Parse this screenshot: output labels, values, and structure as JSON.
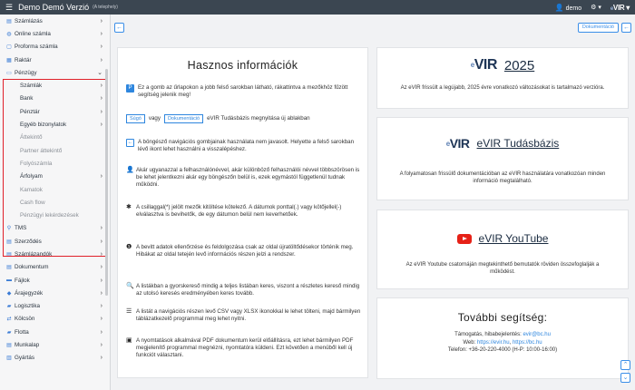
{
  "topbar": {
    "title": "Demo Demó Verzió",
    "subtitle": "(A telephely)",
    "user": "demo",
    "settings_icon": "gear-icon",
    "logo_e": "e",
    "logo_text": "VIR"
  },
  "sidebar": {
    "items": [
      {
        "label": "Számlázás",
        "icon": "document-icon"
      },
      {
        "label": "Online számla",
        "icon": "globe-icon"
      },
      {
        "label": "Proforma számla",
        "icon": "file-icon"
      },
      {
        "label": "Raktár",
        "icon": "warehouse-icon"
      },
      {
        "label": "Pénzügy",
        "icon": "money-icon"
      }
    ],
    "finance_sub": [
      {
        "label": "Számlák",
        "gray": false,
        "chev": true
      },
      {
        "label": "Bank",
        "gray": false,
        "chev": true
      },
      {
        "label": "Pénztár",
        "gray": false,
        "chev": true
      },
      {
        "label": "Egyéb bizonylatok",
        "gray": false,
        "chev": true
      },
      {
        "label": "Áttekintő",
        "gray": true,
        "chev": false
      },
      {
        "label": "Partner áttekintő",
        "gray": true,
        "chev": false
      },
      {
        "label": "Folyószámla",
        "gray": true,
        "chev": false
      },
      {
        "label": "Árfolyam",
        "gray": false,
        "chev": true
      },
      {
        "label": "Kamatok",
        "gray": true,
        "chev": false
      },
      {
        "label": "Cash flow",
        "gray": true,
        "chev": false
      },
      {
        "label": "Pénzügyi lekérdezések",
        "gray": true,
        "chev": false
      }
    ],
    "items_after": [
      {
        "label": "TMS",
        "icon": "pin-icon"
      },
      {
        "label": "Szerződés",
        "icon": "contract-icon"
      },
      {
        "label": "Számlázandók",
        "icon": "invoice-icon"
      },
      {
        "label": "Dokumentum",
        "icon": "document-icon"
      },
      {
        "label": "Fájlok",
        "icon": "folder-icon"
      },
      {
        "label": "Árajegyzék",
        "icon": "tag-icon"
      },
      {
        "label": "Logisztika",
        "icon": "truck-icon"
      },
      {
        "label": "Kölcsön",
        "icon": "loan-icon"
      },
      {
        "label": "Flotta",
        "icon": "car-icon"
      },
      {
        "label": "Munkalap",
        "icon": "worksheet-icon"
      },
      {
        "label": "Gyártás",
        "icon": "factory-icon"
      }
    ]
  },
  "toolbar": {
    "back_icon": "arrow-left-icon",
    "doc_label": "Dokumentáció"
  },
  "info": {
    "title": "Hasznos információk",
    "item1": "Ez a gomb az űrlapokon a jobb felső sarokban látható, rákattintva a mezőkhöz fűzött segítség jelenik meg!",
    "help_tag": "Súgó",
    "vagy": "vagy",
    "doc_tag": "Dokumentáció",
    "tudasbazis_text": "eVIR Tudásbázis megnyitása új ablakban",
    "item3": "A böngésző navigációs gombjainak használata nem javasolt. Helyette a felső sarokban lévő ikont lehet használni a visszalépéshez.",
    "item4": "Akár ugyanazzal a felhasználónévvel, akár különböző felhasználói névvel többszörösen is be lehet jelentkezni akár egy böngészőn belül is, ezek egymástól függetlenül tudnak működni.",
    "item5": "A csillaggal(*) jelölt mezők kitöltése kötelező. A dátumok ponttal(.) vagy kötőjellel(-) elválasztva is bevihetők, de egy dátumon belül nem keverhetőek.",
    "item6": "A bevitt adatok ellenőrzése és feldolgozása csak az oldal újratöltődésekor történik meg. Hibákat az oldal tetején levő információs részen jelzi a rendszer.",
    "item7": "A listákban a gyorskereső mindig a teljes listában keres, viszont a részletes kereső mindig az utolsó keresés eredményében keres tovább.",
    "item8": "A listát a navigációs részen levő CSV vagy XLSX ikonokkal le lehet tölteni, majd bármilyen táblázatkezelő programmal meg lehet nyitni.",
    "item9": "A nyomtatások alkalmával PDF dokumentum kerül előállításra, ezt lehet bármilyen PDF megjelenítő programmal megnézni, nyomtatóra küldeni. Ezt követően a menüből kell új funkciót választani."
  },
  "cards": {
    "c1_e": "e",
    "c1_logo": "VIR",
    "c1_title": "2025",
    "c1_desc": "Az eVIR frissült a legújabb, 2025 évre vonatkozó változásokat is tartalmazó verzióra.",
    "c2_title": "eVIR Tudásbázis",
    "c2_desc": "A folyamatosan frissülő dokumentációban az eVIR használatára vonatkozóan minden információ megtalálható.",
    "c3_title": "eVIR YouTube",
    "c3_desc": "Az eVIR Youtube csatornáján megtekinthető bemutatók röviden összefoglalják a működést.",
    "help_title": "További segítség:",
    "help_line1_label": "Támogatás, hibabejelentés:",
    "help_line1_link": "evir@bc.hu",
    "help_line2_label": "Web:",
    "help_line2_link1": "https://evir.hu",
    "help_line2_sep": ",",
    "help_line2_link2": "https://bc.hu",
    "help_line3": "Telefon: +36-20-220-4000 (H-P: 10:00-16:00)"
  },
  "colors": {
    "topbar": "#3b4651",
    "accent": "#2e86de",
    "highlight": "#e0202a"
  }
}
